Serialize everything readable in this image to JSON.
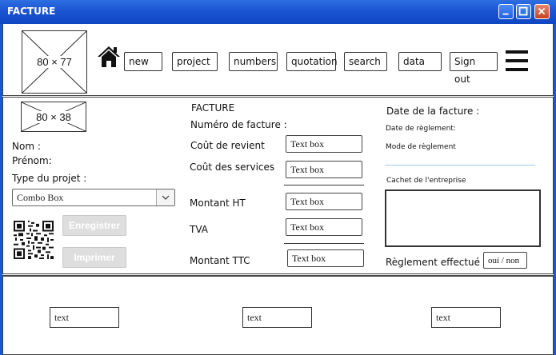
{
  "window": {
    "title": "FACTURE"
  },
  "header": {
    "logo_placeholder": "80 × 77",
    "nav": [
      "new",
      "project",
      "numbers",
      "quotation",
      "search",
      "data",
      "Sign out"
    ]
  },
  "left": {
    "small_placeholder": "80 × 38",
    "nom_label": "Nom :",
    "prenom_label": "Prénom:",
    "type_label": "Type du projet :",
    "combo_value": "Combo Box",
    "save_label": "Enregistrer",
    "print_label": "Imprimer"
  },
  "middle": {
    "heading": "FACTURE",
    "numero_label": "Numéro de facture :",
    "cout_revient_label": "Coût de revient",
    "cout_services_label": "Coût des services",
    "montant_ht_label": "Montant HT",
    "tva_label": "TVA",
    "montant_ttc_label": "Montant TTC",
    "textbox_value": "Text box"
  },
  "right": {
    "date_facture_label": "Date de la facture :",
    "date_reglement_label": "Date de règlement:",
    "mode_reglement_label": "Mode de règlement",
    "cachet_label": "Cachet de l'entreprise",
    "reglement_effectue_label": "Règlement effectué",
    "oui_non": "oui / non"
  },
  "footer": {
    "fields": [
      "text",
      "text",
      "text"
    ]
  },
  "colors": {
    "titlebar": "#1b54d2",
    "disabled_button": "#dedede"
  }
}
